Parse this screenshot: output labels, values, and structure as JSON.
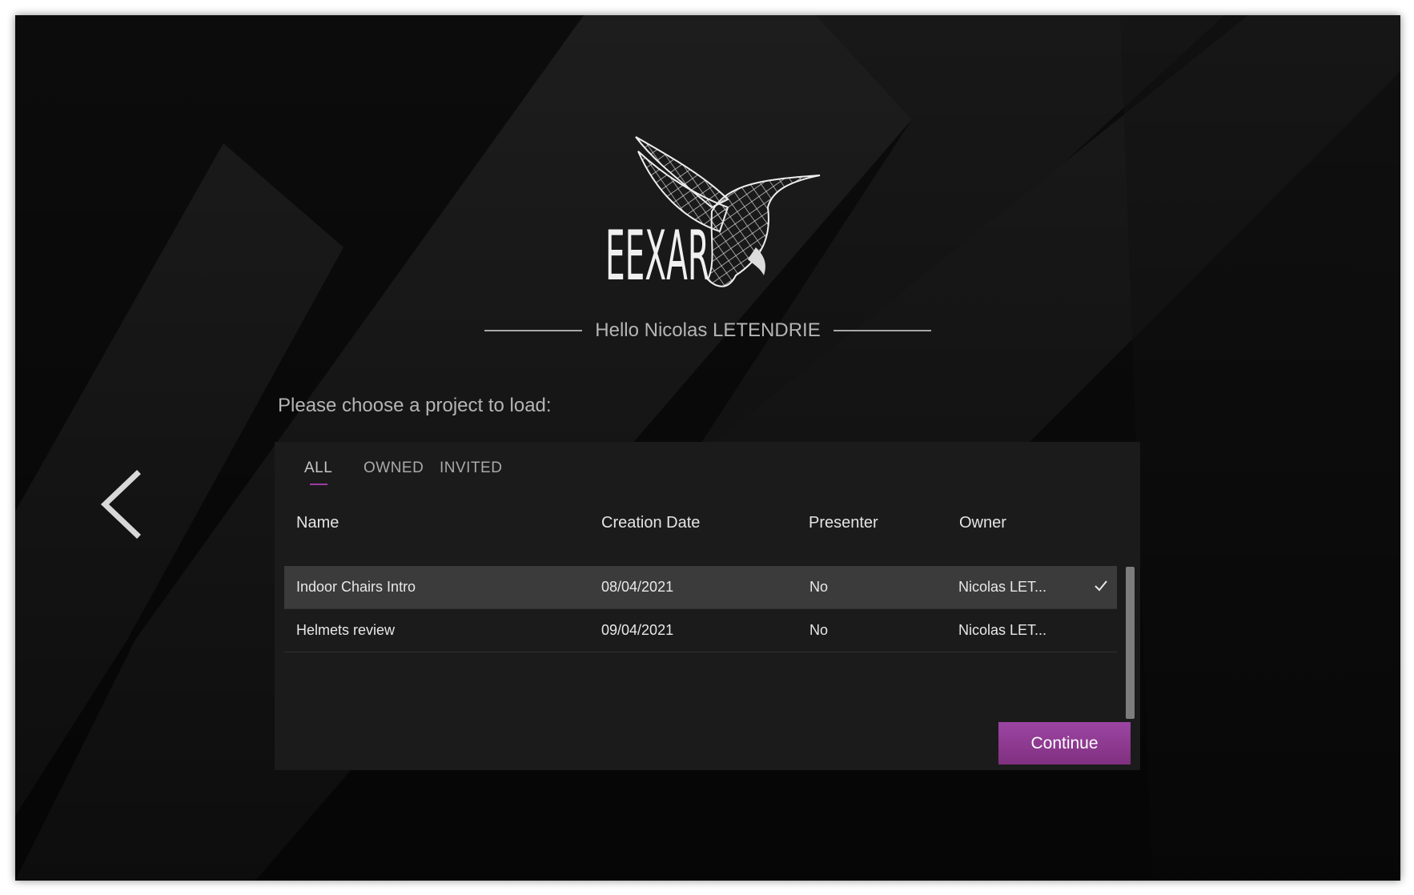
{
  "brand": {
    "logo_text": "EEXAR",
    "accent_color": "#9b3ca3",
    "logo_icon": "hummingbird-icon"
  },
  "greeting": "Hello Nicolas LETENDRIE",
  "prompt": "Please choose a project to load:",
  "back": {
    "icon": "chevron-left-icon"
  },
  "tabs": [
    {
      "label": "ALL",
      "active": true
    },
    {
      "label": "OWNED",
      "active": false
    },
    {
      "label": "INVITED",
      "active": false
    }
  ],
  "table": {
    "columns": [
      "Name",
      "Creation Date",
      "Presenter",
      "Owner"
    ],
    "rows": [
      {
        "name": "Indoor Chairs Intro",
        "date": "08/04/2021",
        "presenter": "No",
        "owner": "Nicolas LET...",
        "selected": true
      },
      {
        "name": "Helmets review",
        "date": "09/04/2021",
        "presenter": "No",
        "owner": "Nicolas LET...",
        "selected": false
      }
    ]
  },
  "continue_label": "Continue"
}
